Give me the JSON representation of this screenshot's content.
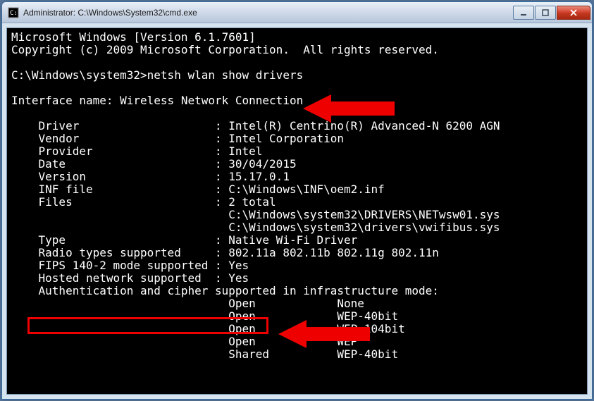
{
  "window": {
    "title": "Administrator: C:\\Windows\\System32\\cmd.exe"
  },
  "console": {
    "line_os": "Microsoft Windows [Version 6.1.7601]",
    "line_copy": "Copyright (c) 2009 Microsoft Corporation.  All rights reserved.",
    "blank": "",
    "prompt": "C:\\Windows\\system32>",
    "command": "netsh wlan show drivers",
    "interface_label": "Interface name: ",
    "interface_value": "Wireless Network Connection",
    "rows": {
      "driver_label": "    Driver                    : ",
      "driver_value": "Intel(R) Centrino(R) Advanced-N 6200 AGN",
      "vendor_label": "    Vendor                    : ",
      "vendor_value": "Intel Corporation",
      "provider_label": "    Provider                  : ",
      "provider_value": "Intel",
      "date_label": "    Date                      : ",
      "date_value": "30/04/2015",
      "version_label": "    Version                   : ",
      "version_value": "15.17.0.1",
      "inf_label": "    INF file                  : ",
      "inf_value": "C:\\Windows\\INF\\oem2.inf",
      "files_label": "    Files                     : ",
      "files_value": "2 total",
      "file1": "                                C:\\Windows\\system32\\DRIVERS\\NETwsw01.sys",
      "file2": "                                C:\\Windows\\system32\\drivers\\vwifibus.sys",
      "type_label": "    Type                      : ",
      "type_value": "Native Wi-Fi Driver",
      "radio_label": "    Radio types supported     : ",
      "radio_value": "802.11a 802.11b 802.11g 802.11n",
      "fips_label": "    FIPS 140-2 mode supported : ",
      "fips_value": "Yes",
      "hosted_label": "    Hosted network supported  : ",
      "hosted_value": "Yes",
      "auth_header": "    Authentication and cipher supported in infrastructure mode:",
      "auth1": "                                Open            None",
      "auth2": "                                Open            WEP-40bit",
      "auth3": "                                Open            WEP-104bit",
      "auth4": "                                Open            WEP",
      "auth5": "                                Shared          WEP-40bit"
    }
  }
}
